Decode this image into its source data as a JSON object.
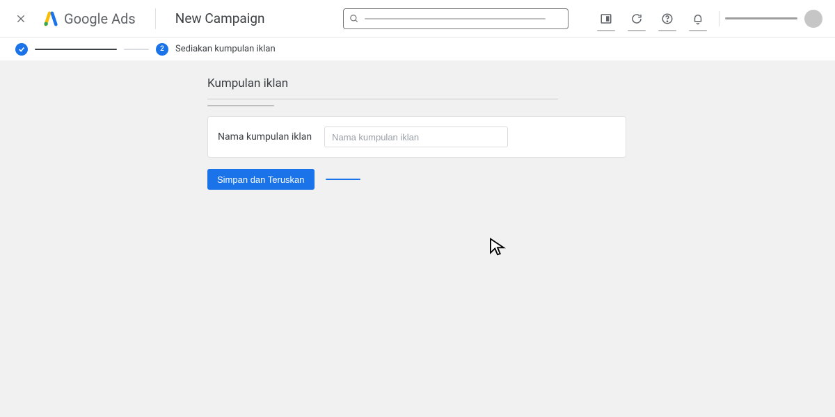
{
  "brand": {
    "google": "Google",
    "ads": "Ads"
  },
  "header": {
    "page_title": "New Campaign"
  },
  "stepper": {
    "step2_number": "2",
    "step2_label": "Sediakan kumpulan iklan"
  },
  "section": {
    "title": "Kumpulan iklan",
    "field_label": "Nama kumpulan iklan",
    "field_placeholder": "Nama kumpulan iklan"
  },
  "actions": {
    "save_continue": "Simpan dan Teruskan"
  }
}
